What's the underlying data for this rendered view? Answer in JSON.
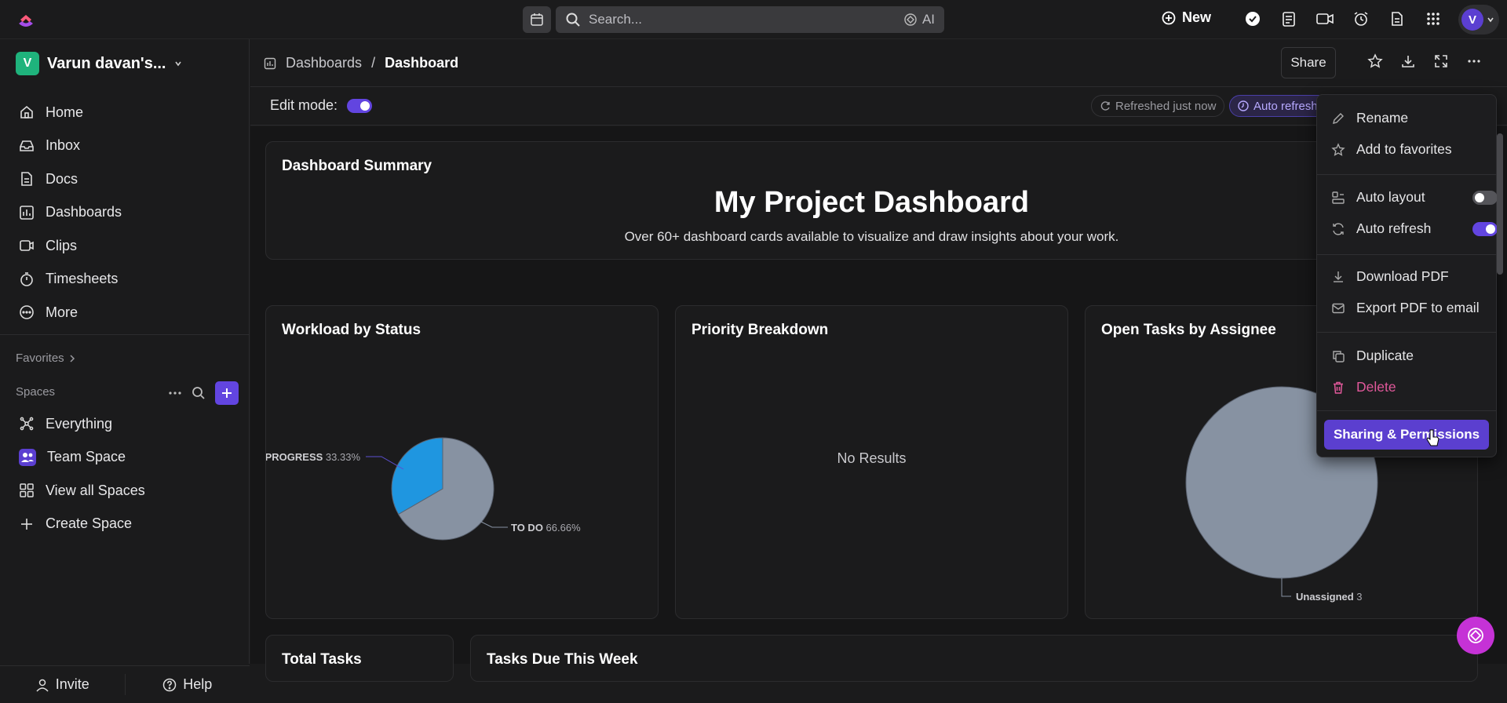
{
  "topbar": {
    "search_placeholder": "Search...",
    "ai_label": "AI",
    "new_label": "New",
    "avatar_initial": "V"
  },
  "sidebar": {
    "workspace_initial": "V",
    "workspace_name": "Varun davan's...",
    "nav": [
      {
        "label": "Home",
        "icon": "home-icon"
      },
      {
        "label": "Inbox",
        "icon": "inbox-icon"
      },
      {
        "label": "Docs",
        "icon": "docs-icon"
      },
      {
        "label": "Dashboards",
        "icon": "dashboards-icon"
      },
      {
        "label": "Clips",
        "icon": "clips-icon"
      },
      {
        "label": "Timesheets",
        "icon": "timesheets-icon"
      },
      {
        "label": "More",
        "icon": "more-icon"
      }
    ],
    "favorites_label": "Favorites",
    "spaces_label": "Spaces",
    "spaces": [
      {
        "label": "Everything",
        "icon": "everything-icon"
      },
      {
        "label": "Team Space",
        "icon": "team-space-icon"
      },
      {
        "label": "View all Spaces",
        "icon": "grid-icon"
      },
      {
        "label": "Create Space",
        "icon": "plus-icon"
      }
    ],
    "invite_label": "Invite",
    "help_label": "Help"
  },
  "header": {
    "breadcrumb_parent": "Dashboards",
    "breadcrumb_sep": "/",
    "breadcrumb_current": "Dashboard",
    "share_label": "Share"
  },
  "subbar": {
    "edit_mode_label": "Edit mode:",
    "edit_mode_on": true,
    "refreshed_label": "Refreshed just now",
    "auto_refresh_label": "Auto refresh"
  },
  "cards": {
    "summary_title": "Dashboard Summary",
    "summary_heading": "My Project Dashboard",
    "summary_text": "Over 60+ dashboard cards available to visualize and draw insights about your work.",
    "workload_title": "Workload by Status",
    "priority_title": "Priority Breakdown",
    "priority_empty": "No Results",
    "assignee_title": "Open Tasks by Assignee",
    "total_title": "Total Tasks",
    "due_title": "Tasks Due This Week"
  },
  "chart_data": [
    {
      "type": "pie",
      "title": "Workload by Status",
      "slices": [
        {
          "label": "IN PROGRESS",
          "value": 33.33,
          "display": "33.33%",
          "color": "#1f96e0"
        },
        {
          "label": "TO DO",
          "value": 66.66,
          "display": "66.66%",
          "color": "#8792a2"
        }
      ]
    },
    {
      "type": "pie",
      "title": "Open Tasks by Assignee",
      "slices": [
        {
          "label": "Unassigned",
          "value": 3,
          "display": "3",
          "color": "#8792a2"
        }
      ]
    }
  ],
  "menu": {
    "items": [
      {
        "label": "Rename",
        "icon": "pencil-icon"
      },
      {
        "label": "Add to favorites",
        "icon": "star-icon"
      },
      {
        "label": "Auto layout",
        "icon": "layout-icon",
        "toggle": false
      },
      {
        "label": "Auto refresh",
        "icon": "refresh-icon",
        "toggle": true
      },
      {
        "label": "Download PDF",
        "icon": "download-icon"
      },
      {
        "label": "Export PDF to email",
        "icon": "mail-icon"
      },
      {
        "label": "Duplicate",
        "icon": "duplicate-icon"
      },
      {
        "label": "Delete",
        "icon": "trash-icon",
        "color": "#e0589a"
      }
    ],
    "sharing_label": "Sharing & Permissions"
  },
  "colors": {
    "accent": "#6245e0",
    "delete": "#e0589a",
    "pie_blue": "#1f96e0",
    "pie_gray": "#8792a2"
  }
}
